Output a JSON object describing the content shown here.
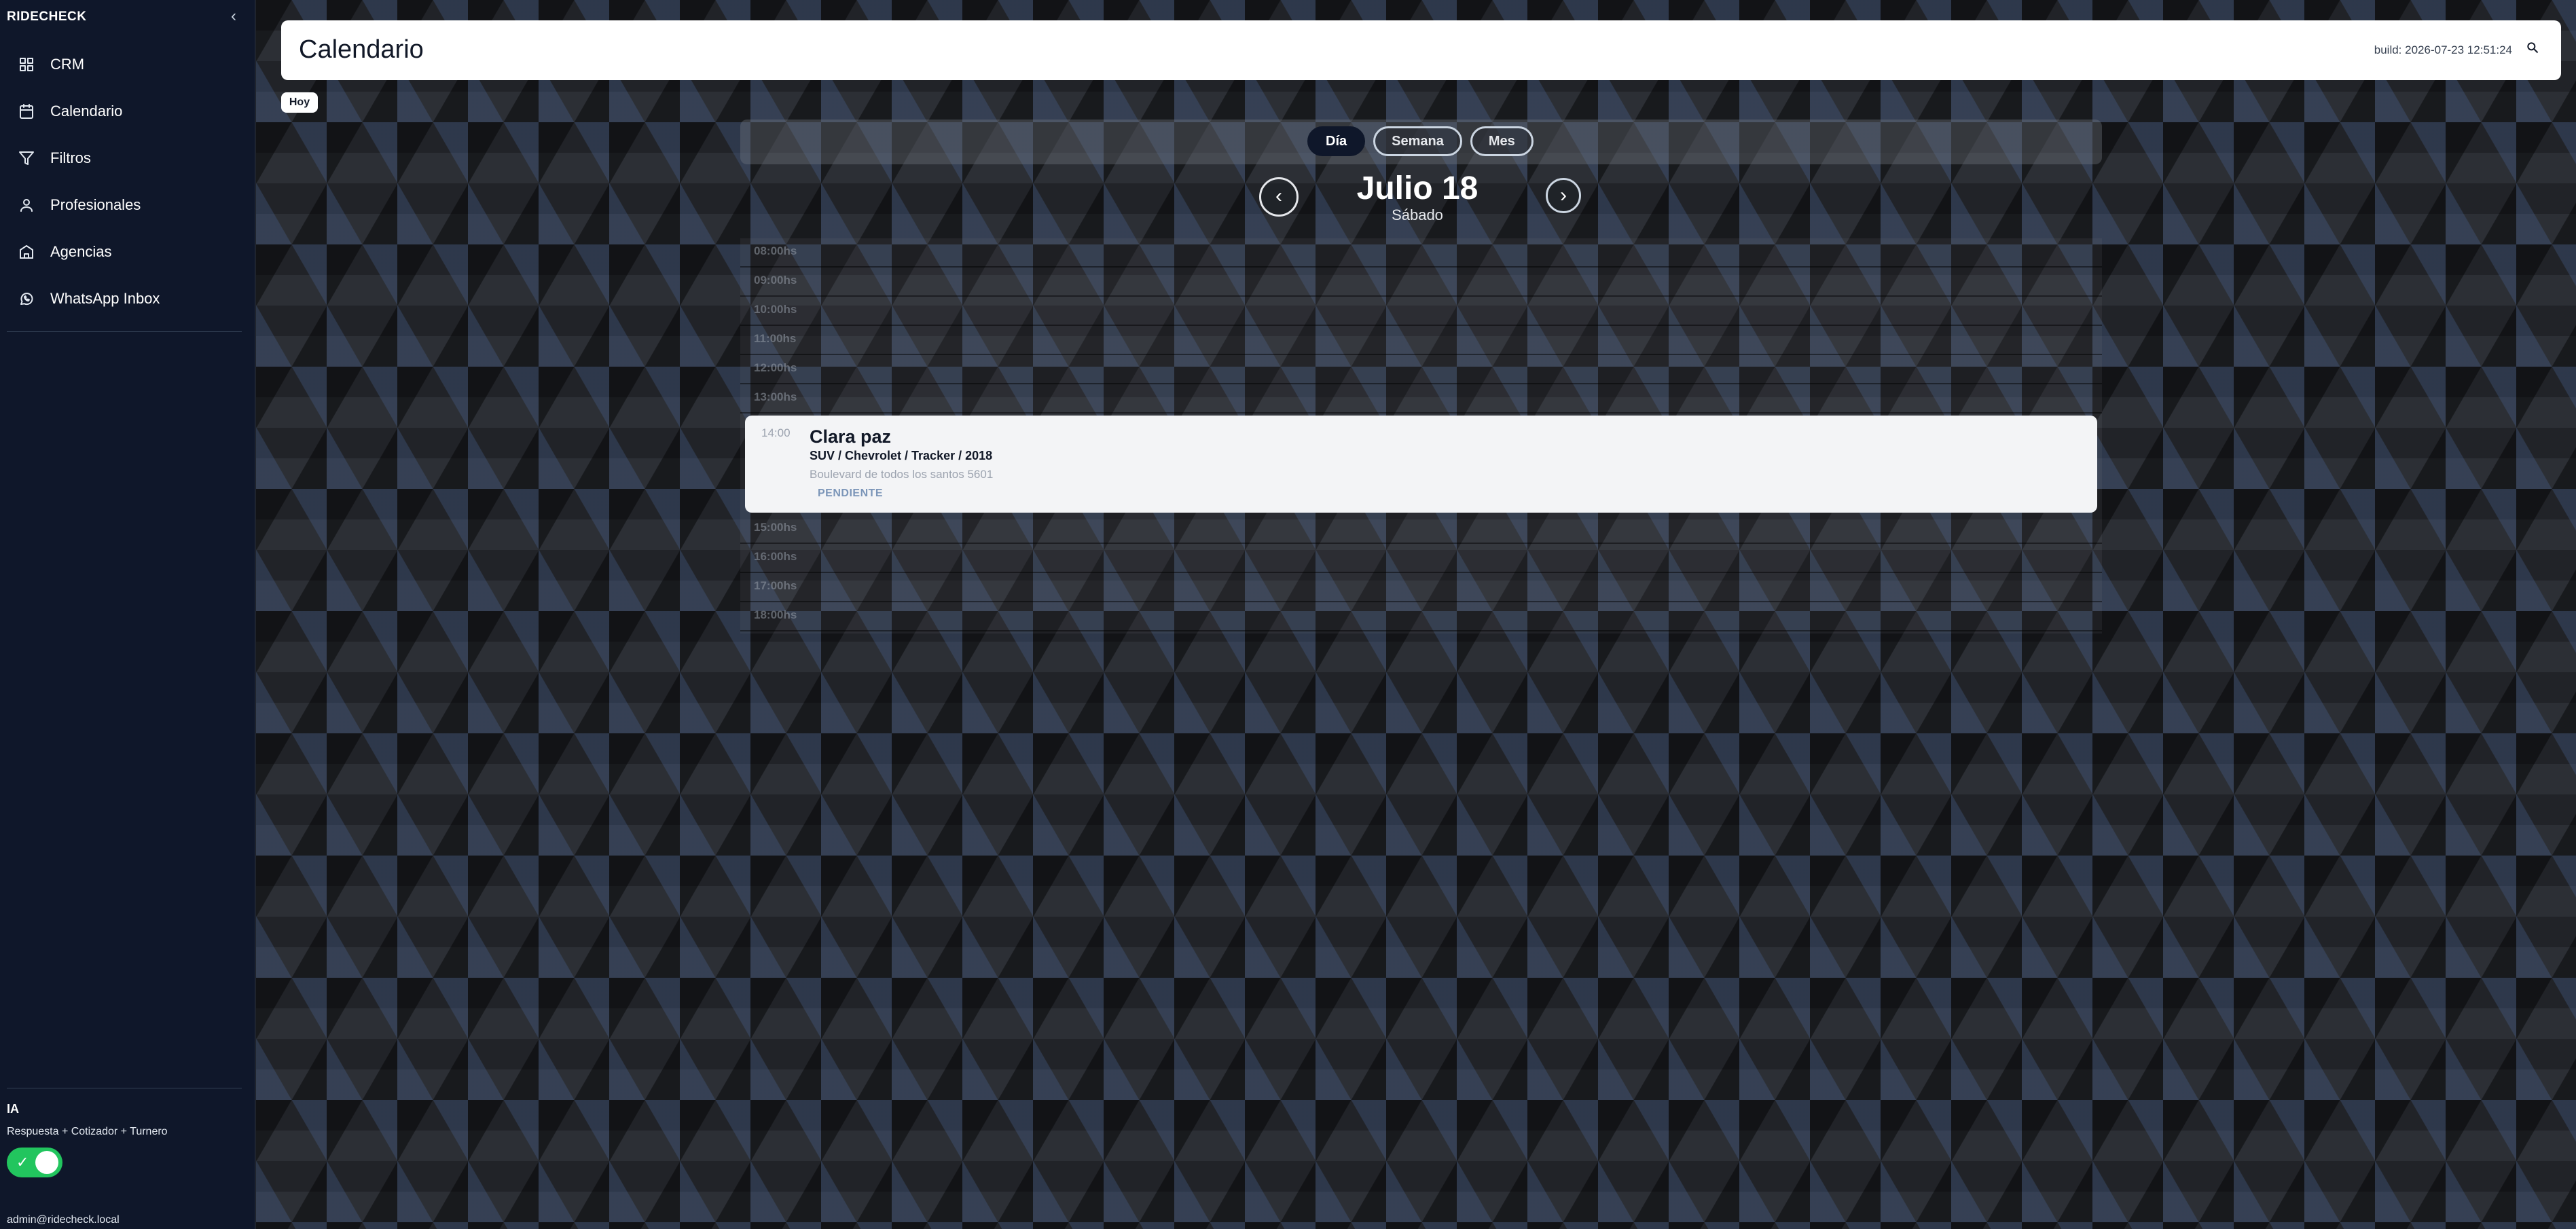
{
  "sidebar": {
    "brand": "RIDECHECK",
    "collapse_icon": "chevron-left-icon",
    "items": [
      {
        "label": "CRM",
        "icon": "grid-icon"
      },
      {
        "label": "Calendario",
        "icon": "calendar-icon"
      },
      {
        "label": "Filtros",
        "icon": "filter-icon"
      },
      {
        "label": "Profesionales",
        "icon": "user-icon"
      },
      {
        "label": "Agencias",
        "icon": "building-icon"
      },
      {
        "label": "WhatsApp Inbox",
        "icon": "whatsapp-icon"
      }
    ],
    "ia": {
      "title": "IA",
      "subtitle": "Respuesta + Cotizador + Turnero",
      "toggle_on": true,
      "toggle_check": "✓"
    },
    "user_email": "admin@ridecheck.local"
  },
  "header": {
    "title": "Calendario",
    "build": "build: 2026-07-23 12:51:24",
    "search_icon": "search-icon"
  },
  "toolbar": {
    "today_label": "Hoy",
    "views": [
      {
        "label": "Día",
        "active": true
      },
      {
        "label": "Semana",
        "active": false
      },
      {
        "label": "Mes",
        "active": false
      }
    ],
    "prev_label": "‹",
    "next_label": "›",
    "date_title": "Julio 18",
    "date_subtitle": "Sábado"
  },
  "timeline": {
    "slots_before": [
      "08:00hs",
      "09:00hs",
      "10:00hs",
      "11:00hs",
      "12:00hs",
      "13:00hs"
    ],
    "slots_after": [
      "15:00hs",
      "16:00hs",
      "17:00hs",
      "18:00hs"
    ]
  },
  "event": {
    "time": "14:00",
    "name": "Clara paz",
    "vehicle": "SUV / Chevrolet / Tracker / 2018",
    "address": "Boulevard de todos los santos 5601",
    "status": "PENDIENTE"
  },
  "colors": {
    "sidebar_bg": "#0f172a",
    "toggle_on": "#22c55e",
    "active_tab": "#0f172a",
    "status_text": "#7b95b8"
  }
}
